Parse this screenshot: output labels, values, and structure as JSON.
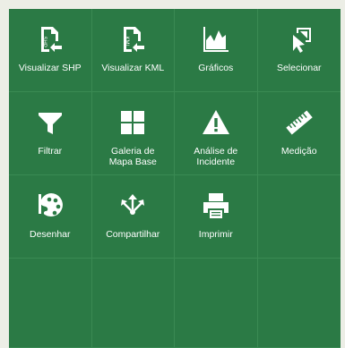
{
  "tools": [
    {
      "label": "Visualizar SHP",
      "icon": "shp-file-import-icon"
    },
    {
      "label": "Visualizar KML",
      "icon": "kml-file-import-icon"
    },
    {
      "label": "Gráficos",
      "icon": "area-chart-icon"
    },
    {
      "label": "Selecionar",
      "icon": "select-cursor-icon"
    },
    {
      "label": "Filtrar",
      "icon": "filter-funnel-icon"
    },
    {
      "label": "Galeria de\nMapa Base",
      "icon": "basemap-gallery-grid-icon"
    },
    {
      "label": "Análise de\nIncidente",
      "icon": "warning-triangle-icon"
    },
    {
      "label": "Medição",
      "icon": "ruler-icon"
    },
    {
      "label": "Desenhar",
      "icon": "palette-icon"
    },
    {
      "label": "Compartilhar",
      "icon": "share-arrows-icon"
    },
    {
      "label": "Imprimir",
      "icon": "printer-icon"
    }
  ],
  "colors": {
    "panel_bg": "#2b7a45",
    "grid_line": "#3a8a53",
    "page_bg": "#eceee6",
    "icon_fg": "#ffffff"
  }
}
